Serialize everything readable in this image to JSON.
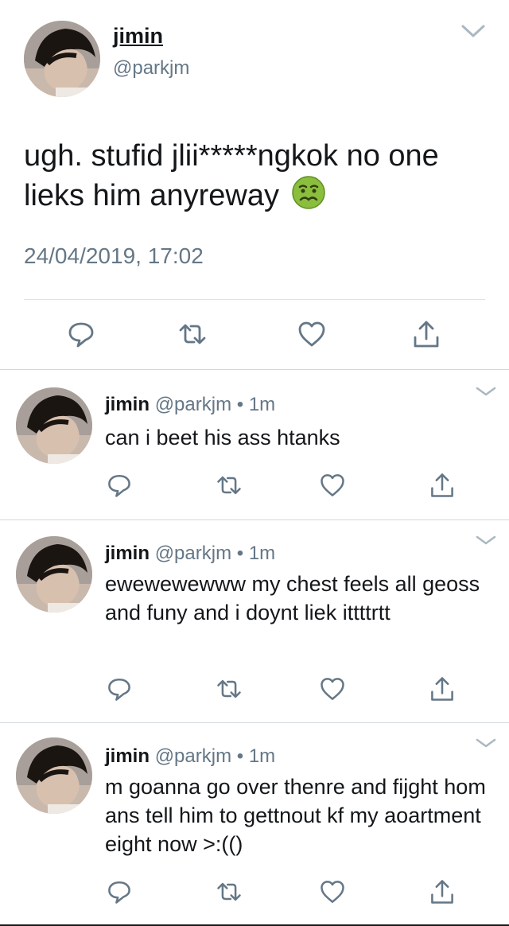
{
  "main_tweet": {
    "author_name": "jimin",
    "author_handle": "@parkjm",
    "text": "ugh. stufid jlii*****ngkok no one lieks him anyreway",
    "emoji": "nauseated-face",
    "timestamp": "24/04/2019, 17:02",
    "actions": [
      "reply-icon",
      "retweet-icon",
      "like-icon",
      "share-icon"
    ]
  },
  "replies": [
    {
      "author_name": "jimin",
      "author_handle": "@parkjm",
      "separator": "•",
      "time_ago": "1m",
      "text": "can i beet his ass htanks"
    },
    {
      "author_name": "jimin",
      "author_handle": "@parkjm",
      "separator": "•",
      "time_ago": "1m",
      "text": "ewewewewww my chest feels all geoss and funy and i doynt liek ittttrtt"
    },
    {
      "author_name": "jimin",
      "author_handle": "@parkjm",
      "separator": "•",
      "time_ago": "1m",
      "text": "m goanna go over thenre and fijght hom ans tell him to gettnout kf my aoartment eight now >:(()"
    }
  ],
  "colors": {
    "text": "#14171a",
    "secondary": "#657786",
    "icon": "#657786",
    "divider": "#dfe3e6"
  }
}
